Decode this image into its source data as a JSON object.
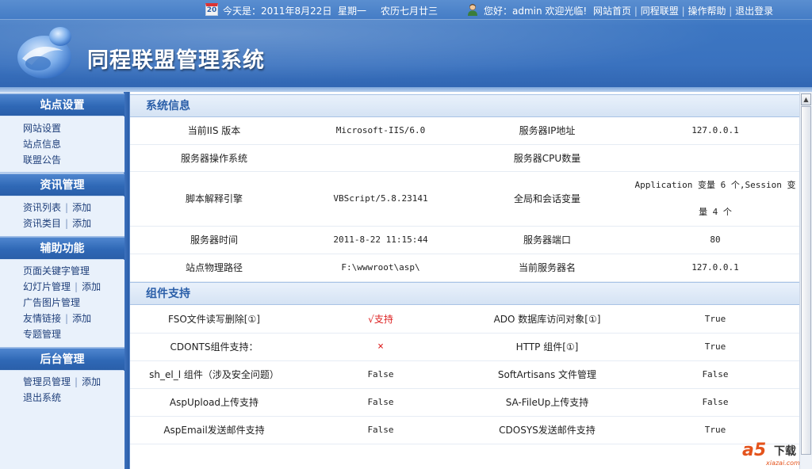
{
  "header": {
    "calendar_day": "20",
    "date_text": "今天是：2011年8月22日",
    "weekday": "星期一",
    "lunar_date": "农历七月廿三",
    "greeting": "您好：admin 欢迎光临!",
    "links": [
      "网站首页",
      "同程联盟",
      "操作帮助",
      "退出登录"
    ],
    "separator": "|",
    "system_title": "同程联盟管理系统"
  },
  "sidebar": {
    "groups": [
      {
        "title": "站点设置",
        "items": [
          {
            "label": "网站设置"
          },
          {
            "label": "站点信息"
          },
          {
            "label": "联盟公告"
          }
        ]
      },
      {
        "title": "资讯管理",
        "items": [
          {
            "label": "资讯列表",
            "add": "添加"
          },
          {
            "label": "资讯类目",
            "add": "添加"
          }
        ]
      },
      {
        "title": "辅助功能",
        "items": [
          {
            "label": "页面关键字管理"
          },
          {
            "label": "幻灯片管理",
            "add": "添加"
          },
          {
            "label": "广告图片管理"
          },
          {
            "label": "友情链接",
            "add": "添加"
          },
          {
            "label": "专题管理"
          }
        ]
      },
      {
        "title": "后台管理",
        "items": [
          {
            "label": "管理员管理",
            "add": "添加"
          },
          {
            "label": "退出系统"
          }
        ]
      }
    ]
  },
  "system_info": {
    "title": "系统信息",
    "rows": [
      [
        "当前IIS 版本",
        "Microsoft-IIS/6.0",
        "服务器IP地址",
        "127.0.0.1"
      ],
      [
        "服务器操作系统",
        "",
        "服务器CPU数量",
        ""
      ],
      [
        "脚本解释引擎",
        "VBScript/5.8.23141",
        "全局和会话变量",
        "Application 变量 6 个,Session 变量 4 个"
      ],
      [
        "服务器时间",
        "2011-8-22 11:15:44",
        "服务器端口",
        "80"
      ],
      [
        "站点物理路径",
        "F:\\wwwroot\\asp\\",
        "当前服务器名",
        "127.0.0.1"
      ]
    ]
  },
  "components": {
    "title": "组件支持",
    "rows": [
      [
        "FSO文件读写删除[①]",
        "√支持",
        "ADO 数据库访问对象[①]",
        "True"
      ],
      [
        "CDONTS组件支持：",
        "×",
        "HTTP 组件[①]",
        "True"
      ],
      [
        "sh_el_l 组件（涉及安全问题）",
        "False",
        "SoftArtisans 文件管理",
        "False"
      ],
      [
        "AspUpload上传支持",
        "False",
        "SA-FileUp上传支持",
        "False"
      ],
      [
        "AspEmail发送邮件支持",
        "False",
        "CDOSYS发送邮件支持",
        "True"
      ]
    ]
  },
  "watermark": {
    "brand": "a5",
    "text": "下载",
    "url": "xiazai.com"
  }
}
